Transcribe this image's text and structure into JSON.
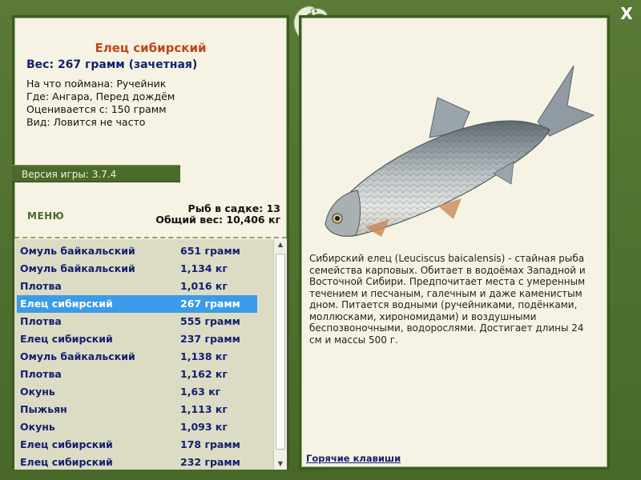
{
  "fish": {
    "title": "Елец сибирский",
    "weight": "Вес: 267 грамм (зачетная)",
    "details": [
      "На что поймана: Ручейник",
      "Где: Ангара, Перед дождём",
      "Оценивается с: 150 грамм",
      "Вид: Ловится не часто"
    ],
    "description": "Сибирский елец (Leuciscus baicalensis) - стайная рыба семейства карповых. Обитает в водоёмах Западной и Восточной Сибири. Предпочитает места с умеренным течением и песчаным, галечным и даже каменистым дном. Питается водными (ручейниками, подёнками, моллюсками, хирономидами) и воздушными беспозвоночными, водорослями. Достигает длины 24 см и массы 500 г."
  },
  "version": "Версия игры: 3.7.4",
  "menu_label": "МЕНЮ",
  "stats": {
    "count": "Рыб в садке: 13",
    "total": "Общий вес: 10,406 кг"
  },
  "catch_list": [
    {
      "name": "Омуль байкальский",
      "value": "651 грамм"
    },
    {
      "name": "Омуль байкальский",
      "value": "1,134 кг"
    },
    {
      "name": "Плотва",
      "value": "1,016 кг"
    },
    {
      "name": "Елец сибирский",
      "value": "267 грамм"
    },
    {
      "name": "Плотва",
      "value": "555 грамм"
    },
    {
      "name": "Елец сибирский",
      "value": "237 грамм"
    },
    {
      "name": "Омуль байкальский",
      "value": "1,138 кг"
    },
    {
      "name": "Плотва",
      "value": "1,162 кг"
    },
    {
      "name": "Окунь",
      "value": "1,63 кг"
    },
    {
      "name": "Пыжьян",
      "value": "1,113 кг"
    },
    {
      "name": "Окунь",
      "value": "1,093 кг"
    },
    {
      "name": "Елец сибирский",
      "value": "178 грамм"
    },
    {
      "name": "Елец сибирский",
      "value": "232 грамм"
    }
  ],
  "selected_index": 3,
  "hotkeys_label": "Горячие клавиши",
  "close_label": "X",
  "icons": {
    "close": "close-icon",
    "ornament": "fish-ornament-icon",
    "scroll_up": "scroll-up-icon",
    "scroll_down": "scroll-down-icon"
  },
  "colors": {
    "frame": "#4e6e2e",
    "panel": "#f7f3e4",
    "title": "#c0461c",
    "text_blue": "#14206e",
    "selected": "#3a9be8"
  }
}
